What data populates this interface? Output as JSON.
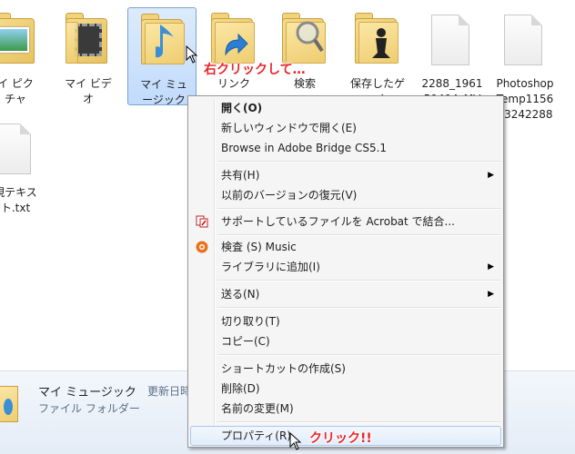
{
  "items": [
    {
      "label": "イ ピク\nチャ",
      "kind": "pictures"
    },
    {
      "label": "マイ ビデ\nオ",
      "kind": "videos"
    },
    {
      "label": "マイ ミュ\nージック",
      "kind": "music"
    },
    {
      "label": "リンク",
      "kind": "links"
    },
    {
      "label": "検索",
      "kind": "search"
    },
    {
      "label": "保存したゲ\nーム",
      "kind": "games"
    },
    {
      "label": "2288_1961\n59494_MV",
      "kind": "file"
    },
    {
      "label": "Photoshop\nTemp1156\n13242288",
      "kind": "file"
    },
    {
      "label": "規テキス\nト.txt",
      "kind": "file"
    }
  ],
  "annotations": {
    "right_click": "右クリックして…",
    "click": "クリック!!"
  },
  "details": {
    "name": "マイ ミュージック",
    "meta": "更新日時",
    "type": "ファイル フォルダー"
  },
  "menu": {
    "open": "開く(O)",
    "open_new_window": "新しいウィンドウで開く(E)",
    "bridge": "Browse in Adobe Bridge CS5.1",
    "share": "共有(H)",
    "restore": "以前のバージョンの復元(V)",
    "acrobat": "サポートしているファイルを Acrobat で結合...",
    "scan": "検査 (S) Music",
    "library": "ライブラリに追加(I)",
    "send_to": "送る(N)",
    "cut": "切り取り(T)",
    "copy": "コピー(C)",
    "shortcut": "ショートカットの作成(S)",
    "delete": "削除(D)",
    "rename": "名前の変更(M)",
    "properties": "プロパティ(R)"
  },
  "colors": {
    "annotation": "#e8262a",
    "selection_border": "#7da2ce",
    "menu_bg": "#f5f5f5"
  }
}
